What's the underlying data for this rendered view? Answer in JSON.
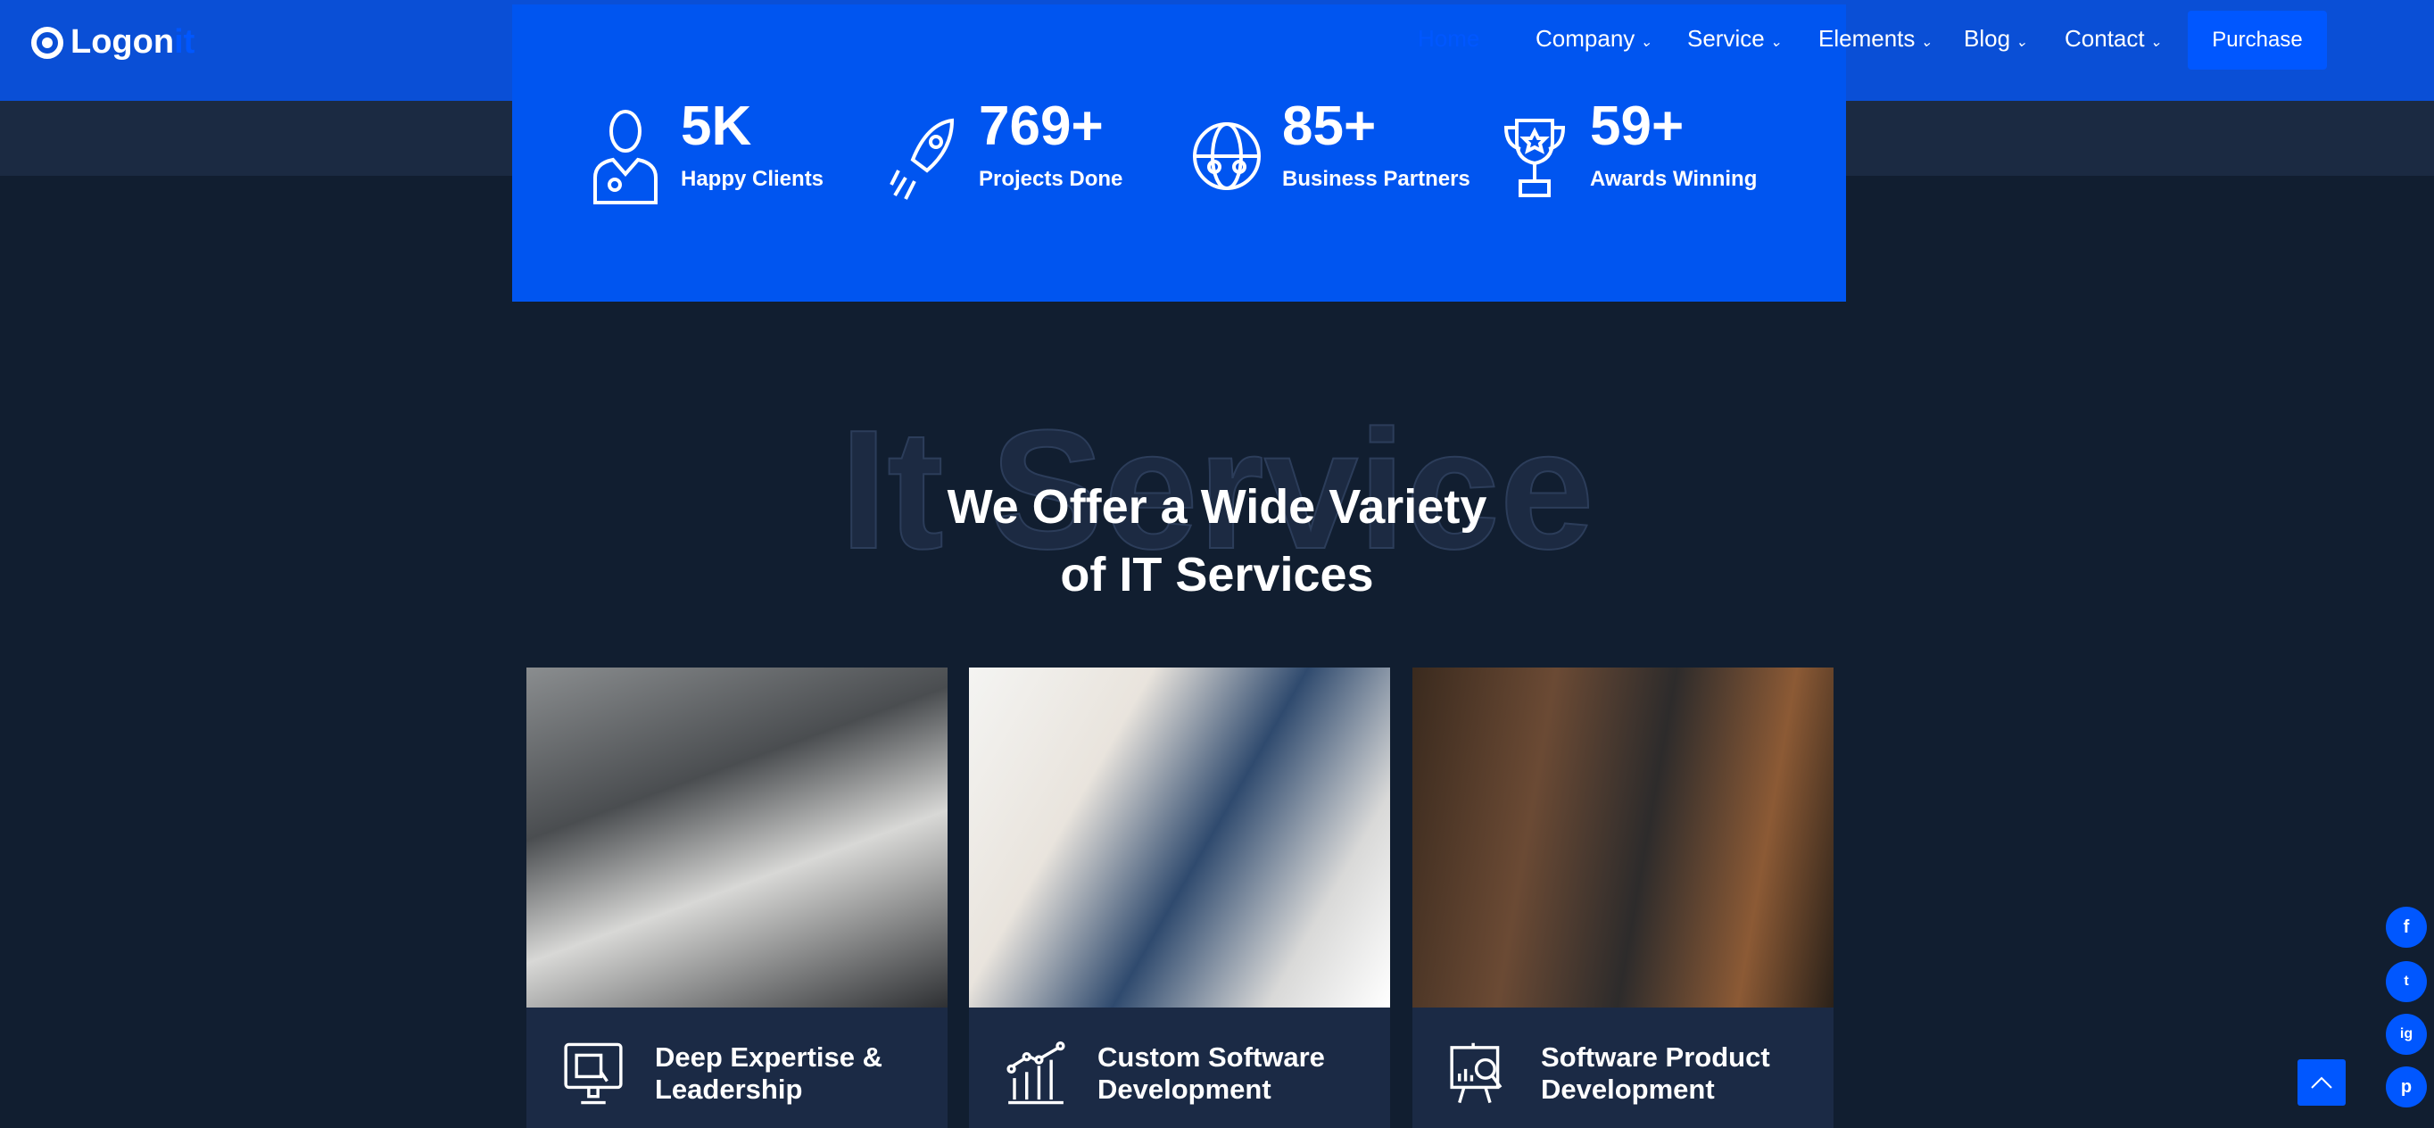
{
  "header": {
    "logo_main": "Logon",
    "logo_accent": "it",
    "nav": [
      {
        "label": "Home",
        "active": true
      },
      {
        "label": "Company"
      },
      {
        "label": "Service"
      },
      {
        "label": "Elements"
      },
      {
        "label": "Blog"
      },
      {
        "label": "Contact"
      }
    ],
    "purchase_label": "Purchase"
  },
  "stats": [
    {
      "value": "5K",
      "label": "Happy Clients",
      "icon": "doctor-icon"
    },
    {
      "value": "769+",
      "label": "Projects Done",
      "icon": "rocket-icon"
    },
    {
      "value": "85+",
      "label": "Business Partners",
      "icon": "globe-people-icon"
    },
    {
      "value": "59+",
      "label": "Awards Winning",
      "icon": "trophy-icon"
    }
  ],
  "section": {
    "ghost": "It Service",
    "title_line1": "We Offer a Wide Variety",
    "title_line2": "of IT Services"
  },
  "cards": [
    {
      "title": "Deep Expertise & Leadership",
      "icon": "monitor-icon"
    },
    {
      "title": "Custom Software Development",
      "icon": "growth-chart-icon"
    },
    {
      "title": "Software Product Development",
      "icon": "presentation-search-icon"
    }
  ],
  "social": [
    "f",
    "t",
    "ig",
    "p"
  ],
  "colors": {
    "accent": "#0057ff",
    "stats_bg": "#0055f0",
    "header_bg": "#0a4fd6",
    "page_bg": "#111e30",
    "card_bg": "#1b2a45"
  }
}
